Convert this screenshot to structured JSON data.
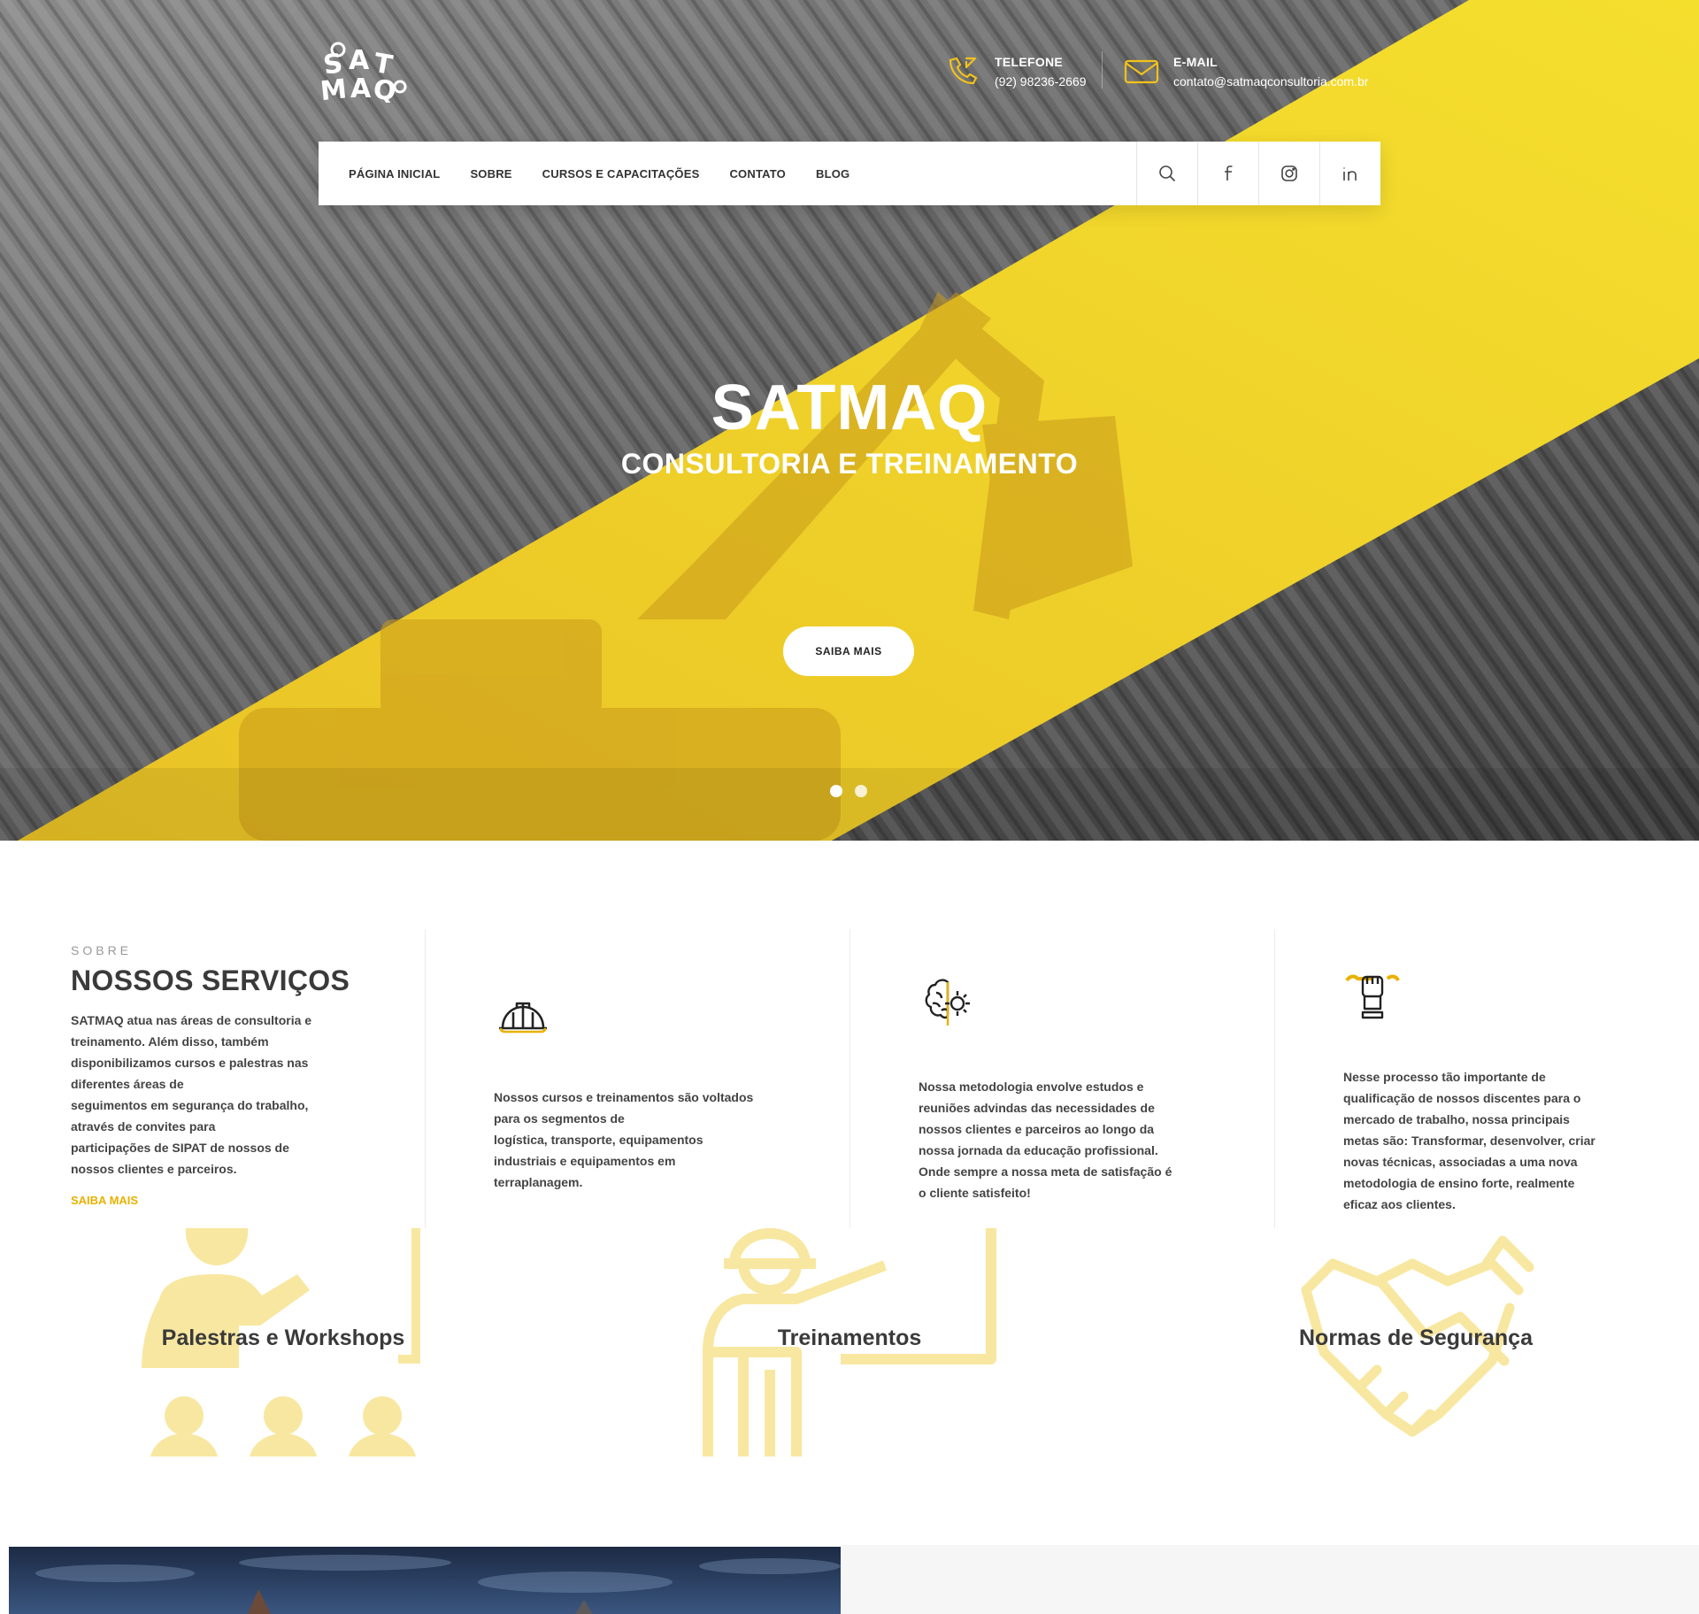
{
  "header": {
    "logo_text": "SATMAQ",
    "phone": {
      "title": "TELEFONE",
      "value": "(92) 98236-2669",
      "icon": "phone-icon"
    },
    "email": {
      "title": "E-MAIL",
      "value": "contato@satmaqconsultoria.com.br",
      "icon": "envelope-icon"
    }
  },
  "nav": {
    "items": [
      {
        "label": "PÁGINA INICIAL"
      },
      {
        "label": "SOBRE"
      },
      {
        "label": "CURSOS E CAPACITAÇÕES"
      },
      {
        "label": "CONTATO"
      },
      {
        "label": "BLOG"
      }
    ],
    "icons": [
      "search-icon",
      "facebook-icon",
      "instagram-icon",
      "linkedin-icon"
    ]
  },
  "hero": {
    "title": "SATMAQ",
    "subtitle": "CONSULTORIA E TREINAMENTO",
    "button": "SAIBA MAIS",
    "slides": 2,
    "active_slide": 1
  },
  "about": {
    "eyebrow": "SOBRE",
    "title": "NOSSOS SERVIÇOS",
    "lines": [
      "SATMAQ atua nas áreas de consultoria e",
      "treinamento. Além disso, também",
      "disponibilizamos cursos e palestras nas",
      "diferentes áreas de",
      "seguimentos em segurança do trabalho,",
      "através de convites para",
      "participações de SIPAT de nossos de",
      "nossos clientes e parceiros."
    ],
    "link": "SAIBA MAIS"
  },
  "services": [
    {
      "icon": "hard-hat-icon",
      "lines": [
        "Nossos cursos e treinamentos são voltados",
        "para os segmentos de",
        "logística, transporte, equipamentos",
        "industriais e equipamentos em",
        "terraplanagem."
      ]
    },
    {
      "icon": "brain-gear-icon",
      "lines": [
        "Nossa metodologia envolve estudos e",
        "reuniões advindas das necessidades de",
        "nossos clientes e parceiros ao longo da",
        "nossa jornada da educação profissional.",
        "Onde sempre a nossa meta de satisfação é",
        "o cliente satisfeito!"
      ]
    },
    {
      "icon": "fist-wrench-icon",
      "lines": [
        "Nesse processo tão importante de",
        "qualificação de nossos discentes para o",
        "mercado de trabalho, nossa principais",
        "metas são: Transformar, desenvolver, criar",
        "novas técnicas, associadas a uma nova",
        "metodologia de ensino forte, realmente",
        "eficaz aos clientes."
      ]
    }
  ],
  "features": [
    {
      "label": "Palestras e Workshops",
      "icon": "presenter-audience-icon"
    },
    {
      "label": "Treinamentos",
      "icon": "instructor-board-icon"
    },
    {
      "label": "Normas de Segurança",
      "icon": "handshake-icon"
    }
  ],
  "colors": {
    "accent": "#f2d52a",
    "accent_dark": "#e8b100",
    "feature_icon": "#f8e7a0",
    "text": "#3a3a3a"
  }
}
